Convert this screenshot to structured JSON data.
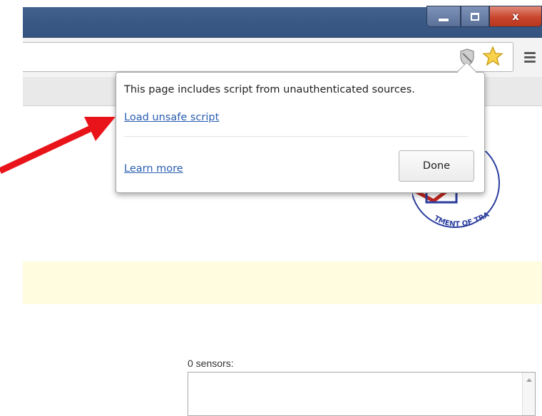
{
  "window": {
    "controls": {
      "minimize_icon": "minimize-icon",
      "maximize_icon": "maximize-icon",
      "close_glyph": "x"
    }
  },
  "toolbar": {
    "shield_icon": "shield-icon",
    "bookmark_icon": "star-icon",
    "menu_icon": "menu-icon"
  },
  "popup": {
    "message": "This page includes script from unauthenticated sources.",
    "load_unsafe_link": "Load unsafe script",
    "learn_more_link": "Learn more",
    "done_button": "Done"
  },
  "page": {
    "logo_text": "TMENT OF TRANSPORTATION",
    "notice_band_color": "#fffce0",
    "sensors_label": "0 sensors:"
  },
  "colors": {
    "link": "#2a5db0",
    "arrow": "#e8141a",
    "titlebar": "#3a5a85"
  }
}
